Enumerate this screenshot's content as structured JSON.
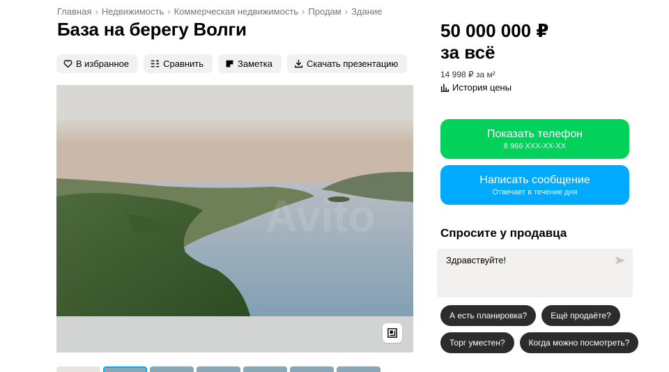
{
  "breadcrumb": [
    "Главная",
    "Недвижимость",
    "Коммерческая недвижимость",
    "Продам",
    "Здание"
  ],
  "title": "База на берегу Волги",
  "actions": {
    "favorite": "В избранное",
    "compare": "Сравнить",
    "note": "Заметка",
    "download": "Скачать презентацию"
  },
  "price": {
    "value": "50 000 000 ₽",
    "period": "за всё",
    "per_m2": "14 998 ₽ за м²",
    "history": "История цены"
  },
  "contact": {
    "phone_label": "Показать телефон",
    "phone_number": "8 966 XXX-XX-XX",
    "message_label": "Написать сообщение",
    "message_sub": "Отвечает в течение дня"
  },
  "ask": {
    "title": "Спросите у продавца",
    "input_value": "Здравствуйте!"
  },
  "quick_questions": [
    "А есть планировка?",
    "Ещё продаёте?",
    "Торг уместен?",
    "Когда можно посмотреть?"
  ],
  "icons": {
    "favorite": "heart-icon",
    "compare": "compare-icon",
    "note": "note-icon",
    "download": "download-icon",
    "history": "bar-chart-icon",
    "send": "send-icon",
    "expand": "expand-icon"
  },
  "colors": {
    "phone_button": "#02d15c",
    "message_button": "#00aaff",
    "chip_background": "#2c2c2c",
    "action_background": "#f2f1f0"
  }
}
